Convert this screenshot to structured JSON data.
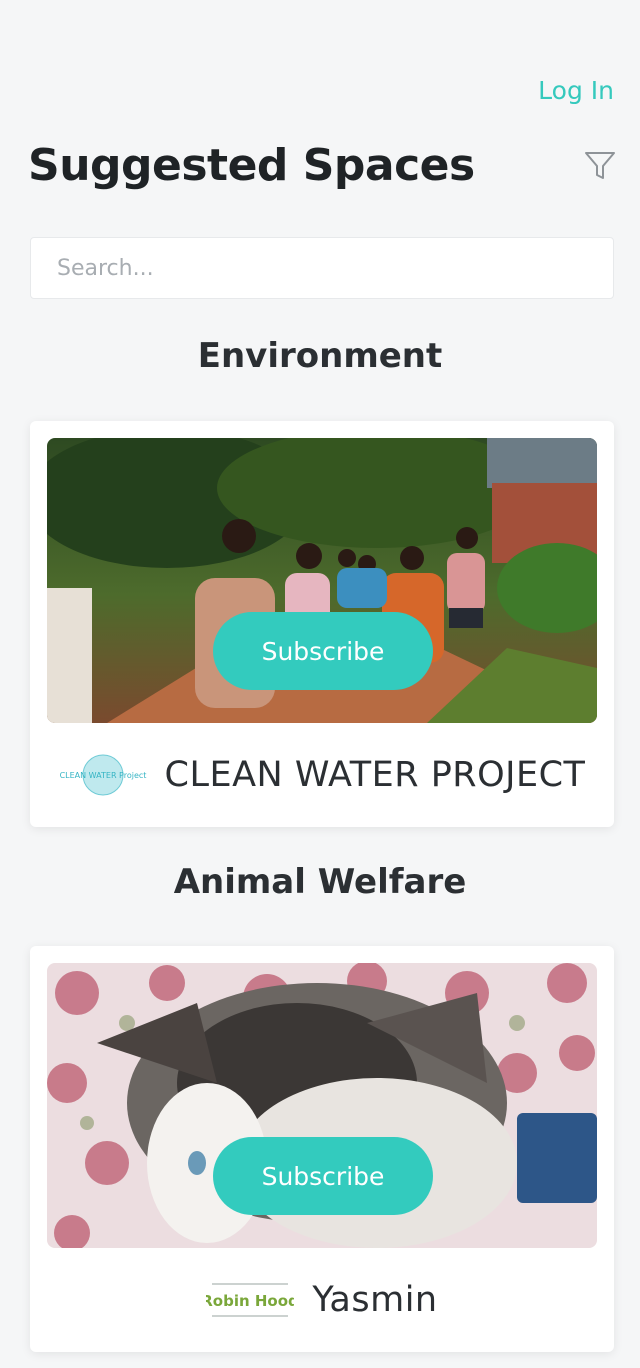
{
  "header": {
    "login_label": "Log In",
    "title": "Suggested Spaces",
    "filter_icon": "filter-icon"
  },
  "search": {
    "placeholder": "Search..."
  },
  "sections": [
    {
      "title": "Environment",
      "card": {
        "subscribe_label": "Subscribe",
        "org_name": "CLEAN WATER PROJECT",
        "logo_text": "CLEAN WATER Project"
      }
    },
    {
      "title": "Animal Welfare",
      "card": {
        "subscribe_label": "Subscribe",
        "org_name": "Yasmin",
        "logo_text": "Robin Hood"
      }
    }
  ],
  "colors": {
    "accent": "#33cbbe",
    "background": "#f5f6f7",
    "text": "#2b2f33"
  }
}
